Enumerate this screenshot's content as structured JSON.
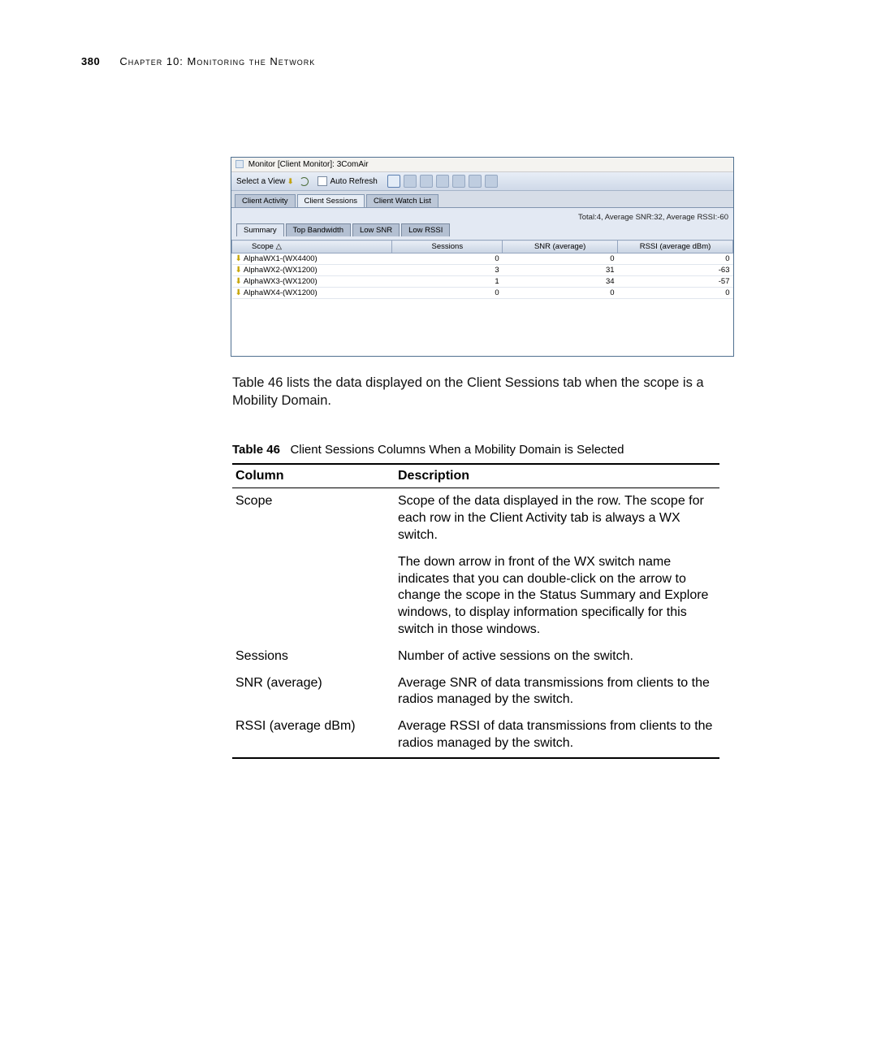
{
  "header": {
    "page_number": "380",
    "chapter": "Chapter 10: Monitoring the Network"
  },
  "screenshot": {
    "window_title": "Monitor [Client Monitor]: 3ComAir",
    "toolbar": {
      "select_view": "Select a View",
      "auto_refresh": "Auto Refresh"
    },
    "tabs": [
      "Client Activity",
      "Client Sessions",
      "Client Watch List"
    ],
    "tabs_selected": 1,
    "stats_text": "Total:4, Average SNR:32, Average RSSI:-60",
    "subtabs": [
      "Summary",
      "Top Bandwidth",
      "Low SNR",
      "Low RSSI"
    ],
    "subtabs_selected": 0,
    "grid_headers": [
      "Scope △",
      "Sessions",
      "SNR (average)",
      "RSSI (average dBm)"
    ],
    "grid_rows": [
      {
        "scope": "AlphaWX1-(WX4400)",
        "sessions": "0",
        "snr": "0",
        "rssi": "0"
      },
      {
        "scope": "AlphaWX2-(WX1200)",
        "sessions": "3",
        "snr": "31",
        "rssi": "-63"
      },
      {
        "scope": "AlphaWX3-(WX1200)",
        "sessions": "1",
        "snr": "34",
        "rssi": "-57"
      },
      {
        "scope": "AlphaWX4-(WX1200)",
        "sessions": "0",
        "snr": "0",
        "rssi": "0"
      }
    ]
  },
  "paragraph": "Table 46 lists the data displayed on the Client Sessions tab when the scope is a Mobility Domain.",
  "table_caption": {
    "label": "Table 46",
    "title": "Client Sessions Columns When a Mobility Domain is Selected"
  },
  "desc_table": {
    "headers": [
      "Column",
      "Description"
    ],
    "rows": [
      {
        "column": "Scope",
        "description": "Scope of the data displayed in the row. The scope for each row in the Client Activity tab is always a WX switch.",
        "description2": "The down arrow in front of the WX switch name indicates that you can double-click on the arrow to change the scope in the Status Summary and Explore windows, to display information specifically for this switch in those windows."
      },
      {
        "column": "Sessions",
        "description": "Number of active sessions on the switch."
      },
      {
        "column": "SNR (average)",
        "description": "Average SNR of data transmissions from clients to the radios managed by the switch."
      },
      {
        "column": "RSSI (average dBm)",
        "description": "Average RSSI of data transmissions from clients to the radios managed by the switch."
      }
    ]
  }
}
